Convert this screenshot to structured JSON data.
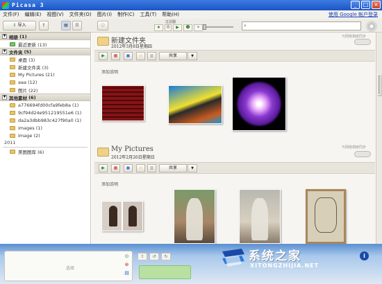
{
  "window": {
    "title": "Picasa 3"
  },
  "menu": {
    "items": [
      "文件(F)",
      "编辑(E)",
      "视图(V)",
      "文件夹(O)",
      "图片(I)",
      "制作(C)",
      "工具(T)",
      "帮助(H)"
    ],
    "account_link": "使用 Google 帐户登录"
  },
  "toolbar": {
    "import_label": "导入",
    "filter_label": "过滤器",
    "filter_count": "0",
    "search": {
      "value": "",
      "placeholder": ""
    }
  },
  "sidebar": {
    "sections": [
      {
        "label": "相册",
        "count": "(1)",
        "items": [
          {
            "label": "最近更新 (13)",
            "icon": "recent-folder-icon"
          }
        ]
      },
      {
        "label": "文件夹",
        "count": "(5)",
        "items": [
          {
            "label": "桌面 (3)"
          },
          {
            "label": "新建文件夹 (3)"
          },
          {
            "label": "My Pictures (21)"
          },
          {
            "label": "aaa (12)"
          },
          {
            "label": "图片 (22)"
          }
        ]
      },
      {
        "label": "其他素材",
        "count": "(6)",
        "items": [
          {
            "label": "a776694fd00cfa9feb8a (1)"
          },
          {
            "label": "9cf94d24e951219551e6 (1)"
          },
          {
            "label": "da2a3dbb983c427f90a0 (1)"
          },
          {
            "label": "images (1)"
          },
          {
            "label": "Image (2)"
          }
        ]
      }
    ],
    "year": "2011",
    "year_items": [
      {
        "label": "美图图库 (6)"
      }
    ]
  },
  "albums": [
    {
      "title": "新建文件夹",
      "date": "2012年3月8日星期四",
      "web_sync": "与网络相册同步",
      "share_label": "共享",
      "add_caption": "添加说明"
    },
    {
      "title": "My Pictures",
      "date": "2012年2月26日星期日",
      "web_sync": "与网络相册同步",
      "share_label": "共享",
      "add_caption": "添加说明"
    }
  ],
  "tray": {
    "label": "选择"
  },
  "watermark": {
    "name": "系统之家",
    "url": "XITONGZHIJIA.NET"
  },
  "colors": {
    "title_bar": "#1d55c6",
    "link": "#1a3fb8",
    "bottom_panel": "#5a8fd0"
  }
}
